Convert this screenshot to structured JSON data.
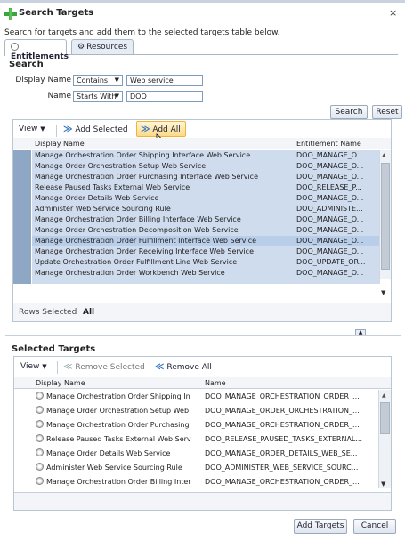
{
  "dialog": {
    "title": "Search Targets",
    "close_glyph": "×",
    "description": "Search for targets and add them to the selected targets table below."
  },
  "tabs": [
    {
      "label": "Entitlements",
      "active": true
    },
    {
      "label": "Resources",
      "active": false
    }
  ],
  "search": {
    "heading": "Search",
    "display_name_label": "Display Name",
    "display_name_operator": "Contains",
    "display_name_value": "Web service",
    "name_label": "Name",
    "name_operator": "Starts With",
    "name_value": "DOO",
    "search_button": "Search",
    "reset_button": "Reset"
  },
  "results_toolbar": {
    "view_label": "View",
    "add_selected_label": "Add Selected",
    "add_all_label": "Add All"
  },
  "results_table": {
    "columns": [
      "Display Name",
      "Entitlement Name"
    ],
    "rows": [
      {
        "display": "Manage Orchestration Order Shipping Interface Web Service",
        "entitlement": "DOO_MANAGE_O..."
      },
      {
        "display": "Manage Order Orchestration Setup Web Service",
        "entitlement": "DOO_MANAGE_O..."
      },
      {
        "display": "Manage Orchestration Order Purchasing Interface Web Service",
        "entitlement": "DOO_MANAGE_O..."
      },
      {
        "display": "Release Paused Tasks External Web Service",
        "entitlement": "DOO_RELEASE_P..."
      },
      {
        "display": "Manage Order Details Web Service",
        "entitlement": "DOO_MANAGE_O..."
      },
      {
        "display": "Administer Web Service Sourcing Rule",
        "entitlement": "DOO_ADMINISTE..."
      },
      {
        "display": "Manage Orchestration Order Billing Interface Web Service",
        "entitlement": "DOO_MANAGE_O..."
      },
      {
        "display": "Manage Order Orchestration Decomposition Web Service",
        "entitlement": "DOO_MANAGE_O..."
      },
      {
        "display": "Manage Orchestration Order Fulfillment Interface Web Service",
        "entitlement": "DOO_MANAGE_O..."
      },
      {
        "display": "Manage Orchestration Order Receiving Interface Web Service",
        "entitlement": "DOO_MANAGE_O..."
      },
      {
        "display": "Update Orchestration Order Fulfillment Line Web Service",
        "entitlement": "DOO_UPDATE_OR..."
      },
      {
        "display": "Manage Orchestration Order Workbench Web Service",
        "entitlement": "DOO_MANAGE_O..."
      }
    ],
    "rows_selected_label": "Rows Selected",
    "rows_selected_value": "All"
  },
  "selected_targets": {
    "heading": "Selected Targets",
    "view_label": "View",
    "remove_selected_label": "Remove Selected",
    "remove_all_label": "Remove All",
    "columns": [
      "Display Name",
      "Name"
    ],
    "rows": [
      {
        "display": "Manage Orchestration Order Shipping In",
        "name": "DOO_MANAGE_ORCHESTRATION_ORDER_..."
      },
      {
        "display": "Manage Order Orchestration Setup Web",
        "name": "DOO_MANAGE_ORDER_ORCHESTRATION_..."
      },
      {
        "display": "Manage Orchestration Order Purchasing",
        "name": "DOO_MANAGE_ORCHESTRATION_ORDER_..."
      },
      {
        "display": "Release Paused Tasks External Web Serv",
        "name": "DOO_RELEASE_PAUSED_TASKS_EXTERNAL..."
      },
      {
        "display": "Manage Order Details Web Service",
        "name": "DOO_MANAGE_ORDER_DETAILS_WEB_SE..."
      },
      {
        "display": "Administer Web Service Sourcing Rule",
        "name": "DOO_ADMINISTER_WEB_SERVICE_SOURC..."
      },
      {
        "display": "Manage Orchestration Order Billing Inter",
        "name": "DOO_MANAGE_ORCHESTRATION_ORDER_..."
      }
    ]
  },
  "footer": {
    "add_targets_button": "Add Targets",
    "cancel_button": "Cancel"
  },
  "colors": {
    "accent_green": "#3aa53a",
    "selected_row": "#cfdcee",
    "highlight_button": "#fbd98a"
  }
}
